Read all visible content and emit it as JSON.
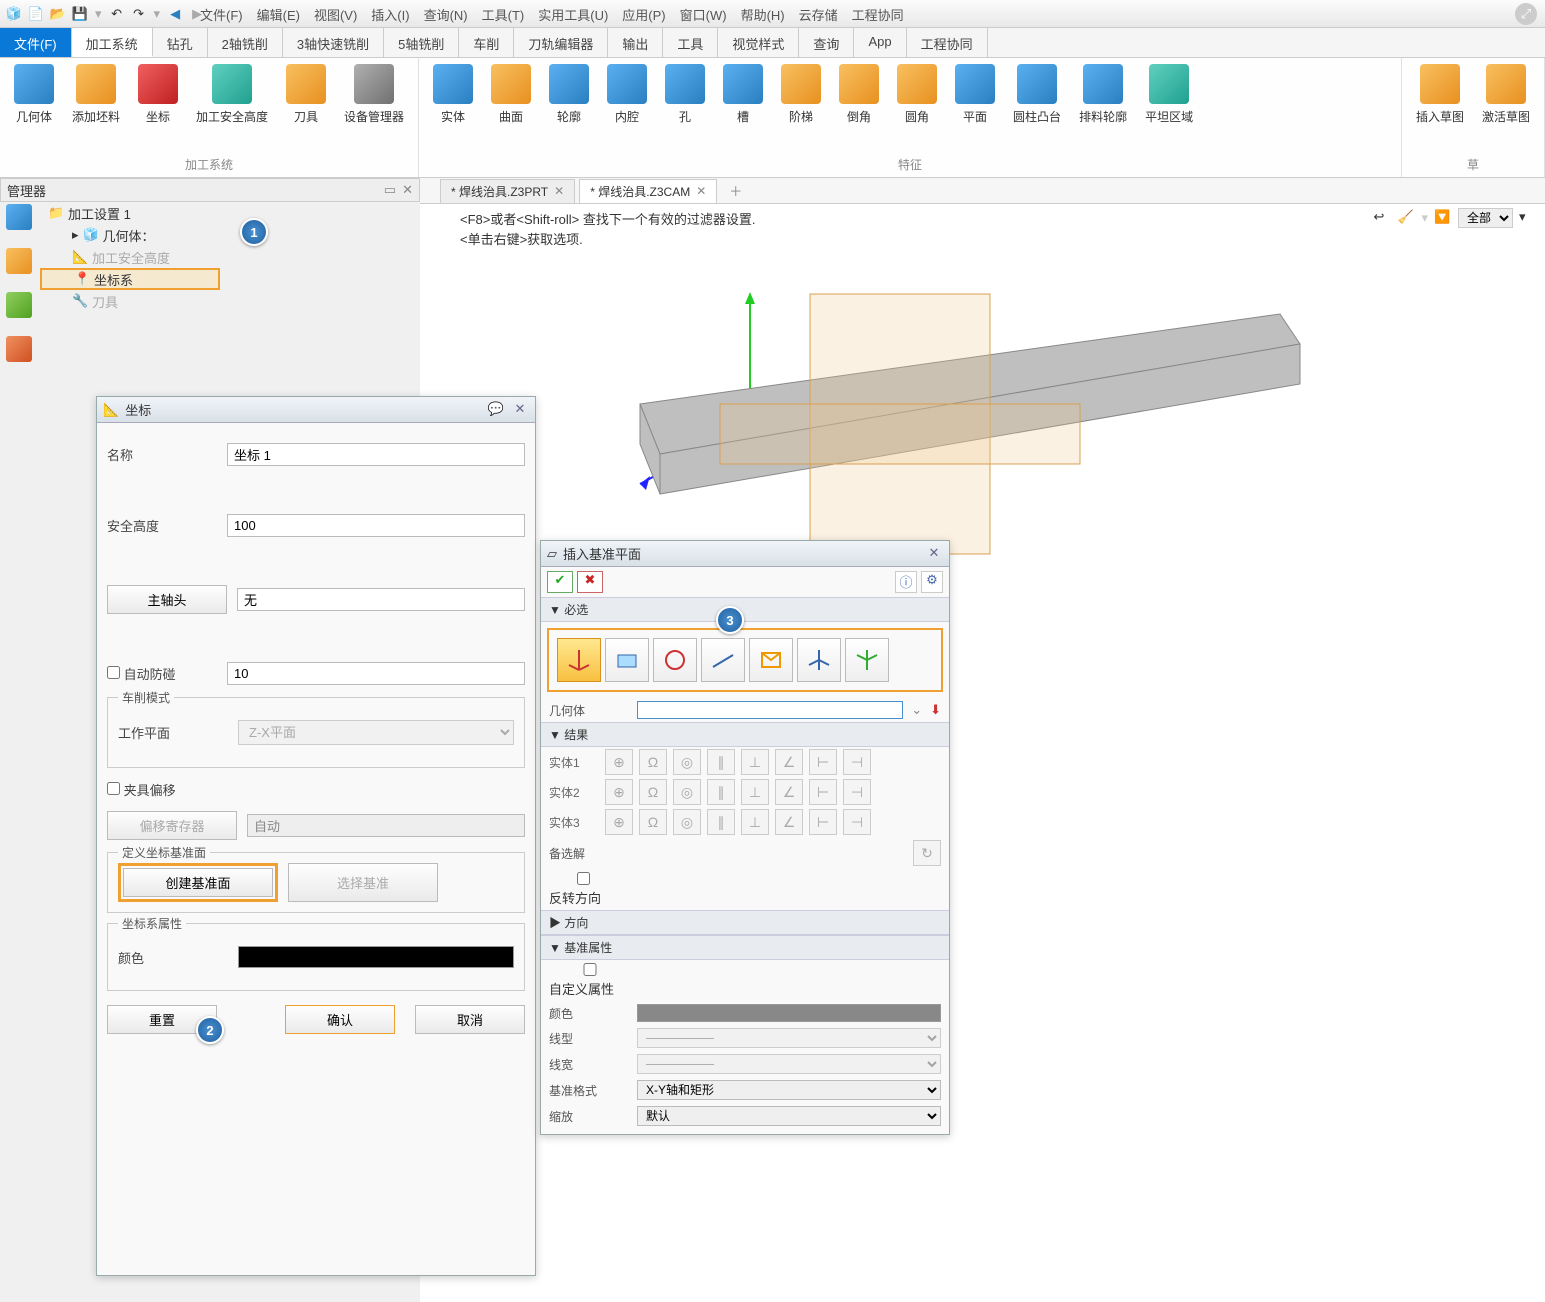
{
  "menus": [
    "文件(F)",
    "编辑(E)",
    "视图(V)",
    "插入(I)",
    "查询(N)",
    "工具(T)",
    "实用工具(U)",
    "应用(P)",
    "窗口(W)",
    "帮助(H)",
    "云存储",
    "工程协同"
  ],
  "tabs": {
    "primary": "文件(F)",
    "items": [
      "加工系统",
      "钻孔",
      "2轴铣削",
      "3轴快速铣削",
      "5轴铣削",
      "车削",
      "刀轨编辑器",
      "输出",
      "工具",
      "视觉样式",
      "查询",
      "App",
      "工程协同"
    ],
    "active": "加工系统"
  },
  "ribbon": {
    "group1": {
      "label": "加工系统",
      "items": [
        "几何体",
        "添加坯料",
        "坐标",
        "加工安全高度",
        "刀具",
        "设备管理器"
      ]
    },
    "group2": {
      "label": "特征",
      "items": [
        "实体",
        "曲面",
        "轮廓",
        "内腔",
        "孔",
        "槽",
        "阶梯",
        "倒角",
        "圆角",
        "平面",
        "圆柱凸台",
        "排料轮廓",
        "平坦区域"
      ]
    },
    "group3": {
      "label": "草",
      "items": [
        "插入草图",
        "激活草图"
      ]
    }
  },
  "manager": {
    "title": "管理器"
  },
  "tree": {
    "root": "加工设置 1",
    "items": [
      "几何体：",
      "加工安全高度",
      "坐标系",
      "刀具"
    ]
  },
  "doc_tabs": [
    {
      "label": "* 焊线治具.Z3PRT",
      "active": false
    },
    {
      "label": "* 焊线治具.Z3CAM",
      "active": true
    }
  ],
  "viewport": {
    "hint_line1": "<F8>或者<Shift-roll> 查找下一个有效的过滤器设置.",
    "hint_line2": "<单击右键>获取选项.",
    "filter": "全部"
  },
  "coord_panel": {
    "title": "坐标",
    "name_label": "名称",
    "name_value": "坐标 1",
    "safe_label": "安全高度",
    "safe_value": "100",
    "spindle_label": "主轴头",
    "spindle_value": "无",
    "anticol_label": "自动防碰",
    "anticol_value": "10",
    "lathe_group": "车削模式",
    "workplane_label": "工作平面",
    "workplane_value": "Z-X平面",
    "clamp_label": "夹具偏移",
    "offset_reg_label": "偏移寄存器",
    "offset_reg_value": "自动",
    "define_group": "定义坐标基准面",
    "create_btn": "创建基准面",
    "select_btn": "选择基准",
    "attr_group": "坐标系属性",
    "color_label": "颜色",
    "reset": "重置",
    "ok": "确认",
    "cancel": "取消"
  },
  "datum_panel": {
    "title": "插入基准平面",
    "required": "▼ 必选",
    "geom_label": "几何体",
    "result": "▼ 结果",
    "entities": [
      "实体1",
      "实体2",
      "实体3"
    ],
    "alt": "备选解",
    "reverse": "反转方向",
    "direction": "▶ 方向",
    "attrs": "▼ 基准属性",
    "custom": "自定义属性",
    "color": "颜色",
    "linetype": "线型",
    "lineweight": "线宽",
    "format_label": "基准格式",
    "format_value": "X-Y轴和矩形",
    "scale_label": "缩放",
    "scale_value": "默认"
  },
  "callouts": {
    "c1": "1",
    "c2": "2",
    "c3": "3"
  }
}
